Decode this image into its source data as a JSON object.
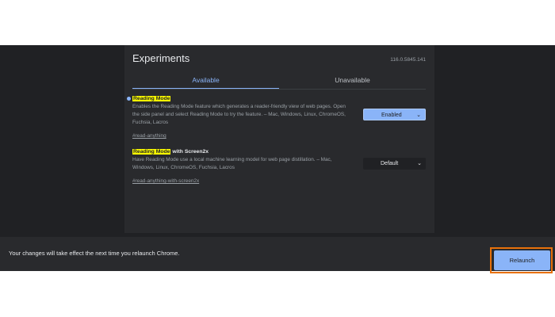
{
  "header": {
    "title": "Experiments",
    "version": "116.0.5845.141"
  },
  "tabs": [
    {
      "label": "Available",
      "active": true
    },
    {
      "label": "Unavailable",
      "active": false
    }
  ],
  "experiments": [
    {
      "name_highlight": "Reading Mode",
      "name_rest": "",
      "description": "Enables the Reading Mode feature which generates a reader-friendly view of web pages. Open the side panel and select Reading Mode to try the feature. – Mac, Windows, Linux, ChromeOS, Fuchsia, Lacros",
      "link": "#read-anything",
      "select_value": "Enabled",
      "modified": true
    },
    {
      "name_highlight": "Reading Mode",
      "name_rest": " with Screen2x",
      "description": "Have Reading Mode use a local machine learning model for web page distillation. – Mac, Windows, Linux, ChromeOS, Fuchsia, Lacros",
      "link": "#read-anything-with-screen2x",
      "select_value": "Default",
      "modified": false
    }
  ],
  "footer": {
    "message": "Your changes will take effect the next time you relaunch Chrome.",
    "relaunch_label": "Relaunch"
  },
  "icons": {
    "chevron": "chevron-down-icon"
  },
  "colors": {
    "accent": "#8ab4f8",
    "highlight": "#fdfd00",
    "focus_outline": "#e8710a",
    "background": "#202124",
    "panel": "#292a2d"
  }
}
